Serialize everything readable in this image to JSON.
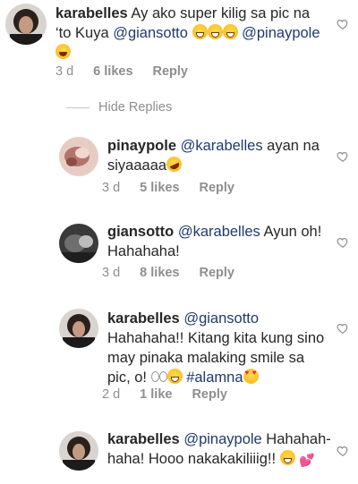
{
  "comments": [
    {
      "username": "karabelles",
      "text_a": "Ay ako super kilig sa pic na ‘to Kuya ",
      "mention_a": "@giansotto",
      "text_b": " ",
      "mention_b": "@pinaypole",
      "time": "3 d",
      "likes": "6 likes",
      "reply": "Reply"
    },
    {
      "username": "pinaypole",
      "mention": "@karabelles",
      "text": " ayan na siyaaaaa",
      "time": "3 d",
      "likes": "5 likes",
      "reply": "Reply"
    },
    {
      "username": "giansotto",
      "mention": "@karabelles",
      "text": " Ayun oh! Hahahaha!",
      "time": "3 d",
      "likes": "8 likes",
      "reply": "Reply"
    },
    {
      "username": "karabelles",
      "mention": "@giansotto",
      "text": " Hahahaha!! Kitang kita kung sino may pinaka malaking smile sa pic, o! ",
      "hashtag": "#alamna",
      "time": "2 d",
      "likes": "1 like",
      "reply": "Reply"
    },
    {
      "username": "karabelles",
      "mention": "@pinaypole",
      "text": " Hahahah-haha! Hooo nakakakiliiig!! ",
      "time": "",
      "likes": "",
      "reply": ""
    }
  ],
  "hide_replies": "Hide Replies",
  "colors": {
    "username": "#262626",
    "mention": "#1e3a6e",
    "meta": "#8e8e8e"
  }
}
